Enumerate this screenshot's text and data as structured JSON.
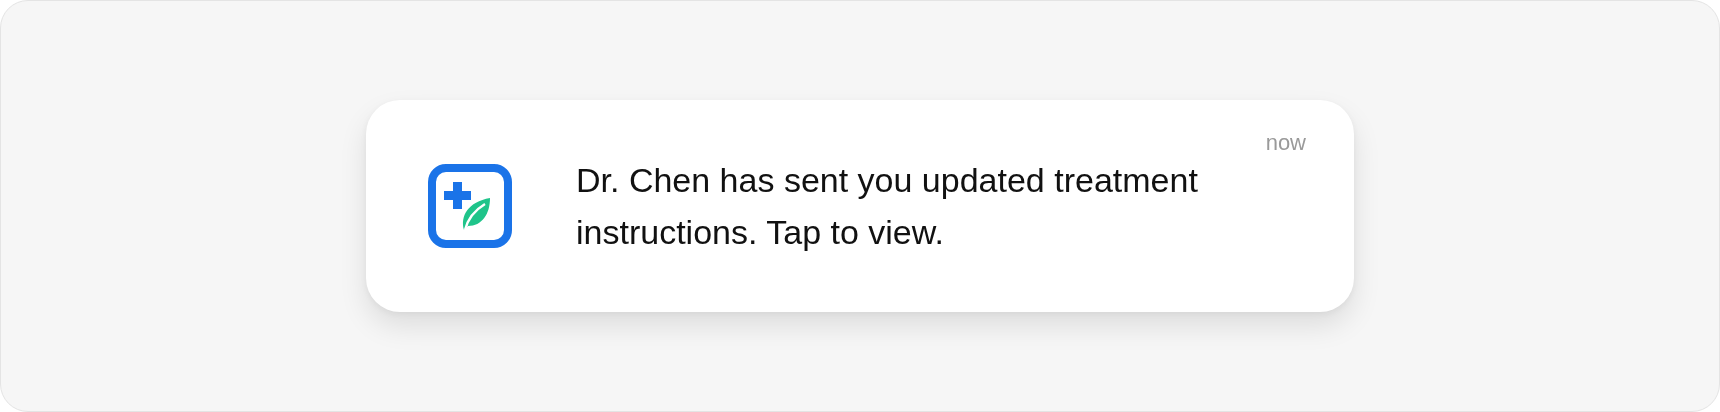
{
  "notification": {
    "time": "now",
    "message": "Dr. Chen has sent you updated treatment instructions. Tap to view."
  }
}
